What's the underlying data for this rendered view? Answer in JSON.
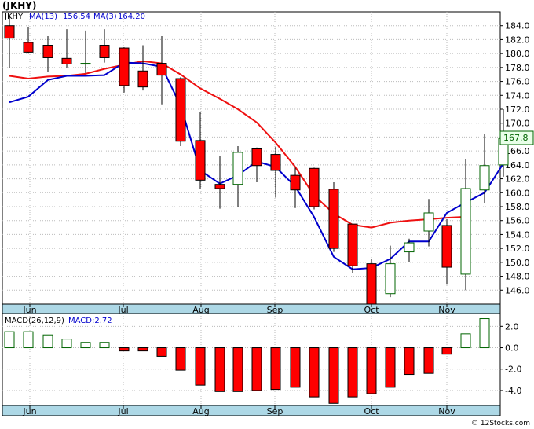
{
  "symbol": "(JKHY)",
  "legend_main": {
    "ticker": "JKHY",
    "ma13_label": "MA(13)",
    "ma13_value": "156.54",
    "ma3_label": "MA(3)",
    "ma3_value": "164.20"
  },
  "legend_macd": {
    "label": "MACD(26,12,9)",
    "value_label": "MACD:2.72"
  },
  "last_price": "167.8",
  "footer": "© 12Stocks.com",
  "colors": {
    "up": "#006400",
    "down": "#ff0000",
    "ma13": "#ee1111",
    "ma3": "#0000cc",
    "axis_band": "#add8e6",
    "price_tag_bg": "#e8ffe8"
  },
  "chart_data": [
    {
      "type": "candlestick",
      "name": "price",
      "x": [
        1,
        2,
        3,
        4,
        5,
        6,
        7,
        8,
        9,
        10,
        11,
        12,
        13,
        14,
        15,
        16,
        17,
        18,
        19,
        20,
        21,
        22,
        23,
        24,
        25
      ],
      "open": [
        184,
        181.6,
        181.2,
        179.3,
        178.6,
        181.2,
        180.8,
        177.5,
        178.6,
        176.4,
        167.5,
        161.2,
        161.2,
        166.3,
        165.5,
        162.5,
        163.5,
        160.5,
        155.5,
        149.8,
        145.5,
        151.5,
        154.5,
        155.3,
        148.3,
        160.4,
        164.0
      ],
      "close": [
        182.2,
        180.2,
        179.4,
        178.5,
        178.6,
        179.4,
        175.4,
        175.2,
        176.9,
        167.4,
        161.8,
        160.6,
        165.8,
        163.9,
        163.2,
        160.4,
        158.0,
        152.0,
        149.5,
        143.4,
        149.8,
        152.8,
        157.1,
        149.3,
        160.6,
        163.9,
        167.8
      ],
      "high": [
        185.5,
        183.8,
        182.5,
        183.5,
        183.3,
        183.5,
        180.9,
        181.2,
        182.5,
        176.6,
        171.6,
        165.3,
        166.7,
        166.5,
        166.6,
        163.6,
        163.6,
        161.5,
        154.5,
        150.5,
        152.4,
        153.4,
        159.1,
        156.2,
        164.8,
        168.5,
        172.0
      ],
      "low": [
        178.0,
        180.0,
        177.3,
        178.0,
        177.2,
        178.7,
        174.4,
        174.7,
        172.7,
        166.7,
        160.5,
        157.7,
        158.0,
        161.5,
        159.3,
        157.8,
        157.6,
        151.5,
        148.5,
        143.0,
        145.0,
        150.0,
        152.3,
        146.8,
        146.0,
        158.5,
        162.3
      ],
      "ma13": [
        176.8,
        176.4,
        176.7,
        176.8,
        177.1,
        177.8,
        178.4,
        178.9,
        178.6,
        177.0,
        175.0,
        173.5,
        172.0,
        170.1,
        167.2,
        163.7,
        159.6,
        157.0,
        155.4,
        155.0,
        155.7,
        156.0,
        156.2,
        156.4,
        156.54
      ],
      "ma3": [
        173.0,
        173.8,
        176.2,
        176.8,
        176.8,
        176.9,
        178.7,
        178.6,
        178.1,
        172.5,
        163.2,
        161.3,
        162.5,
        164.5,
        163.7,
        160.9,
        156.5,
        150.8,
        149.0,
        149.2,
        150.5,
        153.0,
        153.0,
        157.1,
        158.6,
        160.0,
        164.2
      ],
      "ylim": [
        144,
        186
      ],
      "y_ticks": [
        146,
        148,
        150,
        152,
        154,
        156,
        158,
        160,
        162,
        164,
        166,
        168,
        170,
        172,
        174,
        176,
        178,
        180,
        182,
        184
      ],
      "month_labels": [
        "Jun",
        "Jul",
        "Aug",
        "Sep",
        "Oct",
        "Nov"
      ]
    },
    {
      "type": "bar",
      "name": "MACD histogram",
      "values": [
        1.5,
        1.5,
        1.2,
        0.8,
        0.5,
        0.5,
        -0.3,
        -0.3,
        -0.8,
        -2.1,
        -3.5,
        -4.1,
        -4.1,
        -4.0,
        -3.9,
        -3.7,
        -4.6,
        -5.2,
        -4.6,
        -4.3,
        -3.7,
        -2.5,
        -2.4,
        -0.6,
        1.3,
        2.72
      ],
      "ylim": [
        -5.4,
        3.2
      ],
      "y_ticks": [
        2.0,
        0.0,
        -2.0,
        -4.0
      ],
      "y_tick_labels": [
        "2.0",
        "0.0",
        "-2.0",
        "-4.0"
      ],
      "month_labels": [
        "Jun",
        "Jul",
        "Aug",
        "Sep",
        "Oct",
        "Nov"
      ]
    }
  ]
}
